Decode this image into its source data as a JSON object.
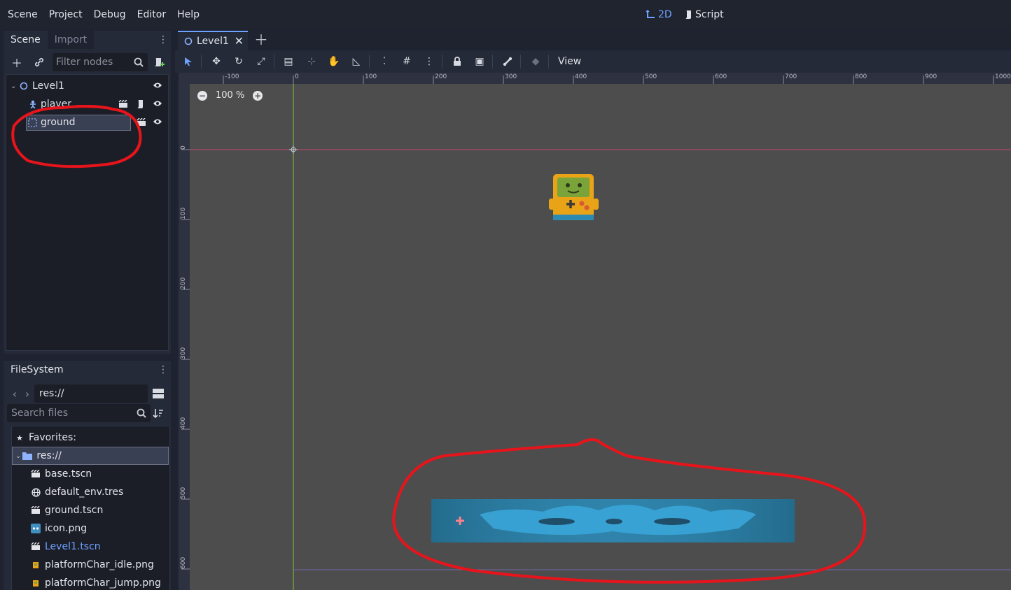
{
  "menu": [
    "Scene",
    "Project",
    "Debug",
    "Editor",
    "Help"
  ],
  "modes": {
    "twod": "2D",
    "script": "Script"
  },
  "scene_dock": {
    "tabs": [
      "Scene",
      "Import"
    ],
    "filter_placeholder": "Filter nodes",
    "nodes": [
      {
        "label": "Level1"
      },
      {
        "label": "player"
      },
      {
        "label": "ground"
      }
    ]
  },
  "filesystem": {
    "tab": "FileSystem",
    "path": "res://",
    "search_placeholder": "Search files",
    "favorites": "Favorites:",
    "root": "res://",
    "files": [
      "base.tscn",
      "default_env.tres",
      "ground.tscn",
      "icon.png",
      "Level1.tscn",
      "platformChar_idle.png",
      "platformChar_jump.png"
    ]
  },
  "editor": {
    "scene_tab": "Level1",
    "view_menu": "View",
    "zoom": "100 %",
    "ruler_top": [
      "-100",
      "0",
      "100",
      "200",
      "300",
      "400",
      "500",
      "600",
      "700",
      "800",
      "900",
      "1000"
    ],
    "ruler_left": [
      "0",
      "100",
      "200",
      "300",
      "400",
      "500",
      "600"
    ]
  },
  "colors": {
    "accent": "#6ea0ff",
    "annotation": "#e8141b",
    "viewport": "#4d4d4d"
  }
}
